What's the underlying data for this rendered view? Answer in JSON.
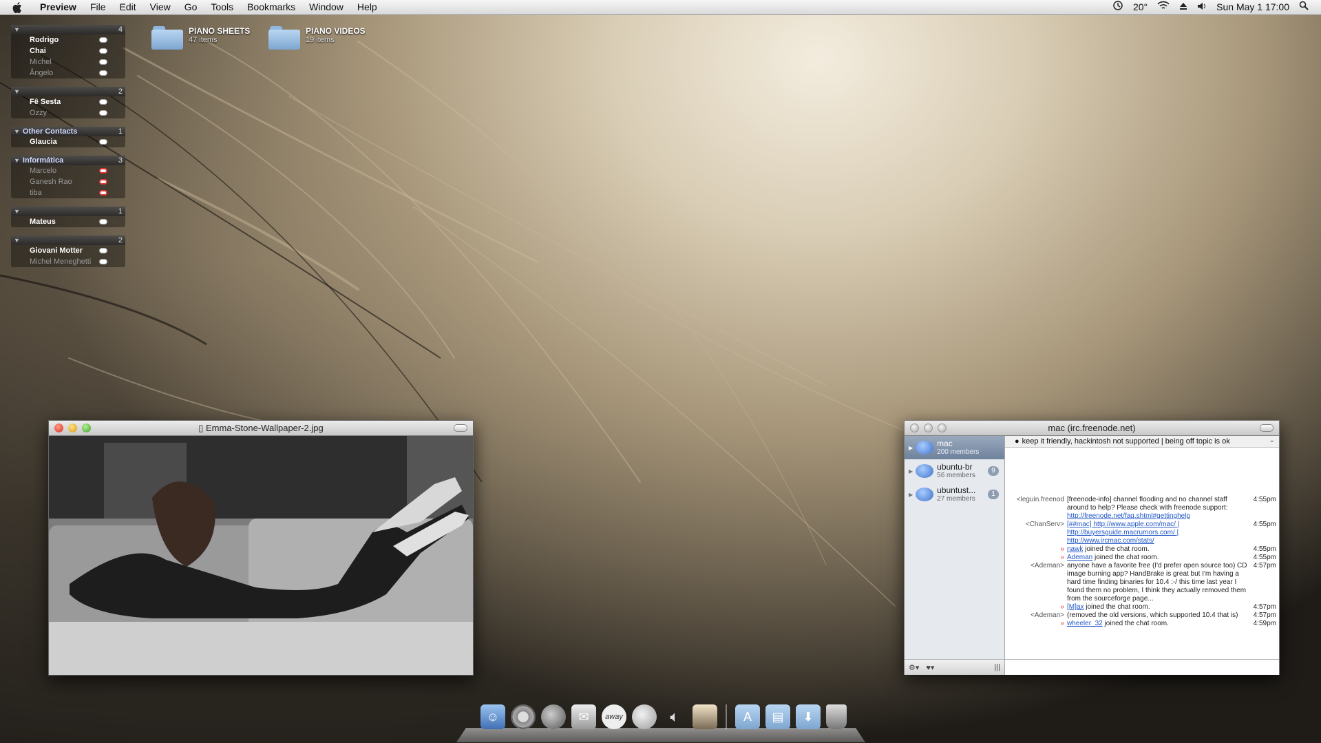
{
  "menubar": {
    "app_name": "Preview",
    "items": [
      "File",
      "Edit",
      "View",
      "Go",
      "Tools",
      "Bookmarks",
      "Window",
      "Help"
    ],
    "temperature": "20°",
    "clock": "Sun May 1  17:00"
  },
  "buddy_groups": [
    {
      "name": "",
      "count": "4",
      "buddies": [
        {
          "name": "Rodrigo",
          "idle": false,
          "status": "available"
        },
        {
          "name": "Chai",
          "idle": false,
          "status": "available"
        },
        {
          "name": "Michel",
          "idle": true,
          "status": "available"
        },
        {
          "name": "Ângelo",
          "idle": true,
          "status": "available"
        }
      ]
    },
    {
      "name": "",
      "count": "2",
      "buddies": [
        {
          "name": "Fê Sesta",
          "idle": false,
          "status": "available"
        },
        {
          "name": "Ozzy",
          "idle": true,
          "status": "available"
        }
      ]
    },
    {
      "name": "Other Contacts",
      "count": "1",
      "buddies": [
        {
          "name": "Glaucia",
          "idle": false,
          "status": "available"
        }
      ]
    },
    {
      "name": "Informática",
      "count": "3",
      "buddies": [
        {
          "name": "Marcelo",
          "idle": true,
          "status": "away"
        },
        {
          "name": "Ganesh Rao",
          "idle": true,
          "status": "away"
        },
        {
          "name": "tiba",
          "idle": true,
          "status": "away"
        }
      ]
    },
    {
      "name": "",
      "count": "1",
      "buddies": [
        {
          "name": "Mateus",
          "idle": false,
          "status": "available"
        }
      ]
    },
    {
      "name": "",
      "count": "2",
      "buddies": [
        {
          "name": "Giovani Motter",
          "idle": false,
          "status": "available"
        },
        {
          "name": "Michel Meneghetti",
          "idle": true,
          "status": "available"
        }
      ]
    }
  ],
  "desktop_folders": [
    {
      "name": "PIANO SHEETS",
      "sub": "47 items"
    },
    {
      "name": "PIANO VIDEOS",
      "sub": "19 items"
    }
  ],
  "preview": {
    "title": "Emma-Stone-Wallpaper-2.jpg"
  },
  "irc": {
    "title": "mac (irc.freenode.net)",
    "topic": "keep it friendly, hackintosh not supported | being off topic is ok",
    "channels": [
      {
        "name": "mac",
        "members": "200 members",
        "badge": "",
        "selected": true
      },
      {
        "name": "ubuntu-br",
        "members": "56 members",
        "badge": "9",
        "selected": false
      },
      {
        "name": "ubuntust...",
        "members": "27 members",
        "badge": "1",
        "selected": false
      }
    ],
    "messages": [
      {
        "nick": "<leguin.freenod",
        "text": "[freenode-info] channel flooding and no channel staff around to help? Please check with freenode support: ",
        "link": "http://freenode.net/faq.shtml#gettinghelp",
        "time": "4:55pm"
      },
      {
        "nick": "<ChanServ>",
        "text": "",
        "link": "[##mac]  http://www.apple.com/mac/ | http://buyersguide.macrumors.com/ | http://www.ircmac.com/stats/",
        "time": "4:55pm"
      },
      {
        "nick": "",
        "text": " joined the chat room.",
        "link": "nawk",
        "time": "4:55pm",
        "join": true
      },
      {
        "nick": "",
        "text": " joined the chat room.",
        "link": "Ademan",
        "time": "4:55pm",
        "join": true
      },
      {
        "nick": "<Ademan>",
        "text": "anyone have a favorite free (I'd prefer open source too) CD image burning app? HandBrake is great but I'm having a hard time finding binaries for 10.4 :-/ this time last year I found them no problem, I think they actually removed them from the sourceforge page...",
        "link": "",
        "time": "4:57pm"
      },
      {
        "nick": "",
        "text": " joined the chat room.",
        "link": "[M]ax",
        "time": "4:57pm",
        "join": true
      },
      {
        "nick": "<Ademan>",
        "text": "(removed the old versions, which supported 10.4 that is)",
        "link": "",
        "time": "4:57pm"
      },
      {
        "nick": "",
        "text": " joined the chat room.",
        "link": "wheeler_32",
        "time": "4:59pm",
        "join": true
      }
    ]
  },
  "dock": {
    "items": [
      "finder-icon",
      "chrome-icon",
      "firefox-icon",
      "mail-icon",
      "away-chat-icon",
      "messages-icon",
      "volume-icon",
      "photos-icon",
      "applications-folder-icon",
      "documents-folder-icon",
      "downloads-folder-icon",
      "trash-icon"
    ],
    "away_label": "away"
  },
  "colors": {
    "link": "#1f56c7",
    "selected_channel": "#6f829c",
    "away_status": "#dd3333"
  }
}
